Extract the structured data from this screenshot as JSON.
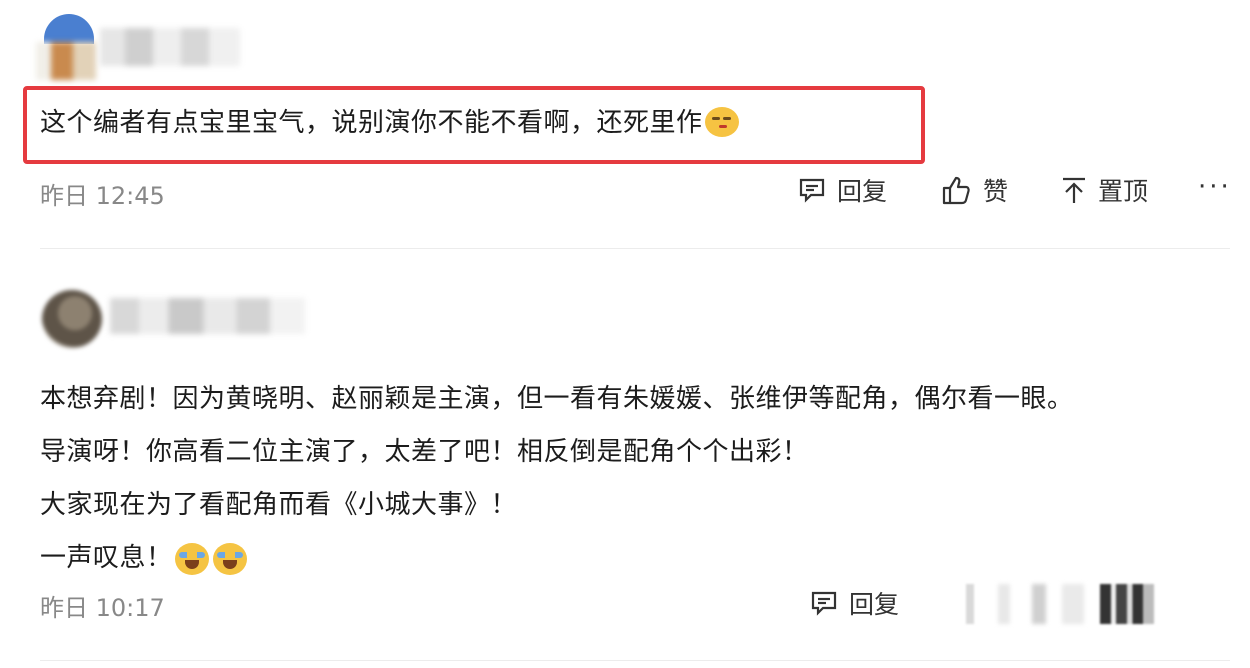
{
  "comments": [
    {
      "text": "这个编者有点宝里宝气，说别演你不能不看啊，还死里作",
      "emoji": "smirk-emoji",
      "time": "昨日 12:45",
      "actions": {
        "reply": "回复",
        "like": "赞",
        "pin": "置顶",
        "more": "···"
      },
      "highlighted": true
    },
    {
      "lines": [
        "本想弃剧！因为黄晓明、赵丽颖是主演，但一看有朱媛媛、张维伊等配角，偶尔看一眼。",
        "导演呀！你高看二位主演了，太差了吧！相反倒是配角个个出彩！",
        "大家现在为了看配角而看《小城大事》！",
        "一声叹息！"
      ],
      "emoji": "crying-emoji",
      "time": "昨日 10:17",
      "actions": {
        "reply": "回复"
      }
    }
  ],
  "colors": {
    "highlight": "#e53a3f",
    "time": "#888888",
    "text": "#1c1c1c"
  }
}
